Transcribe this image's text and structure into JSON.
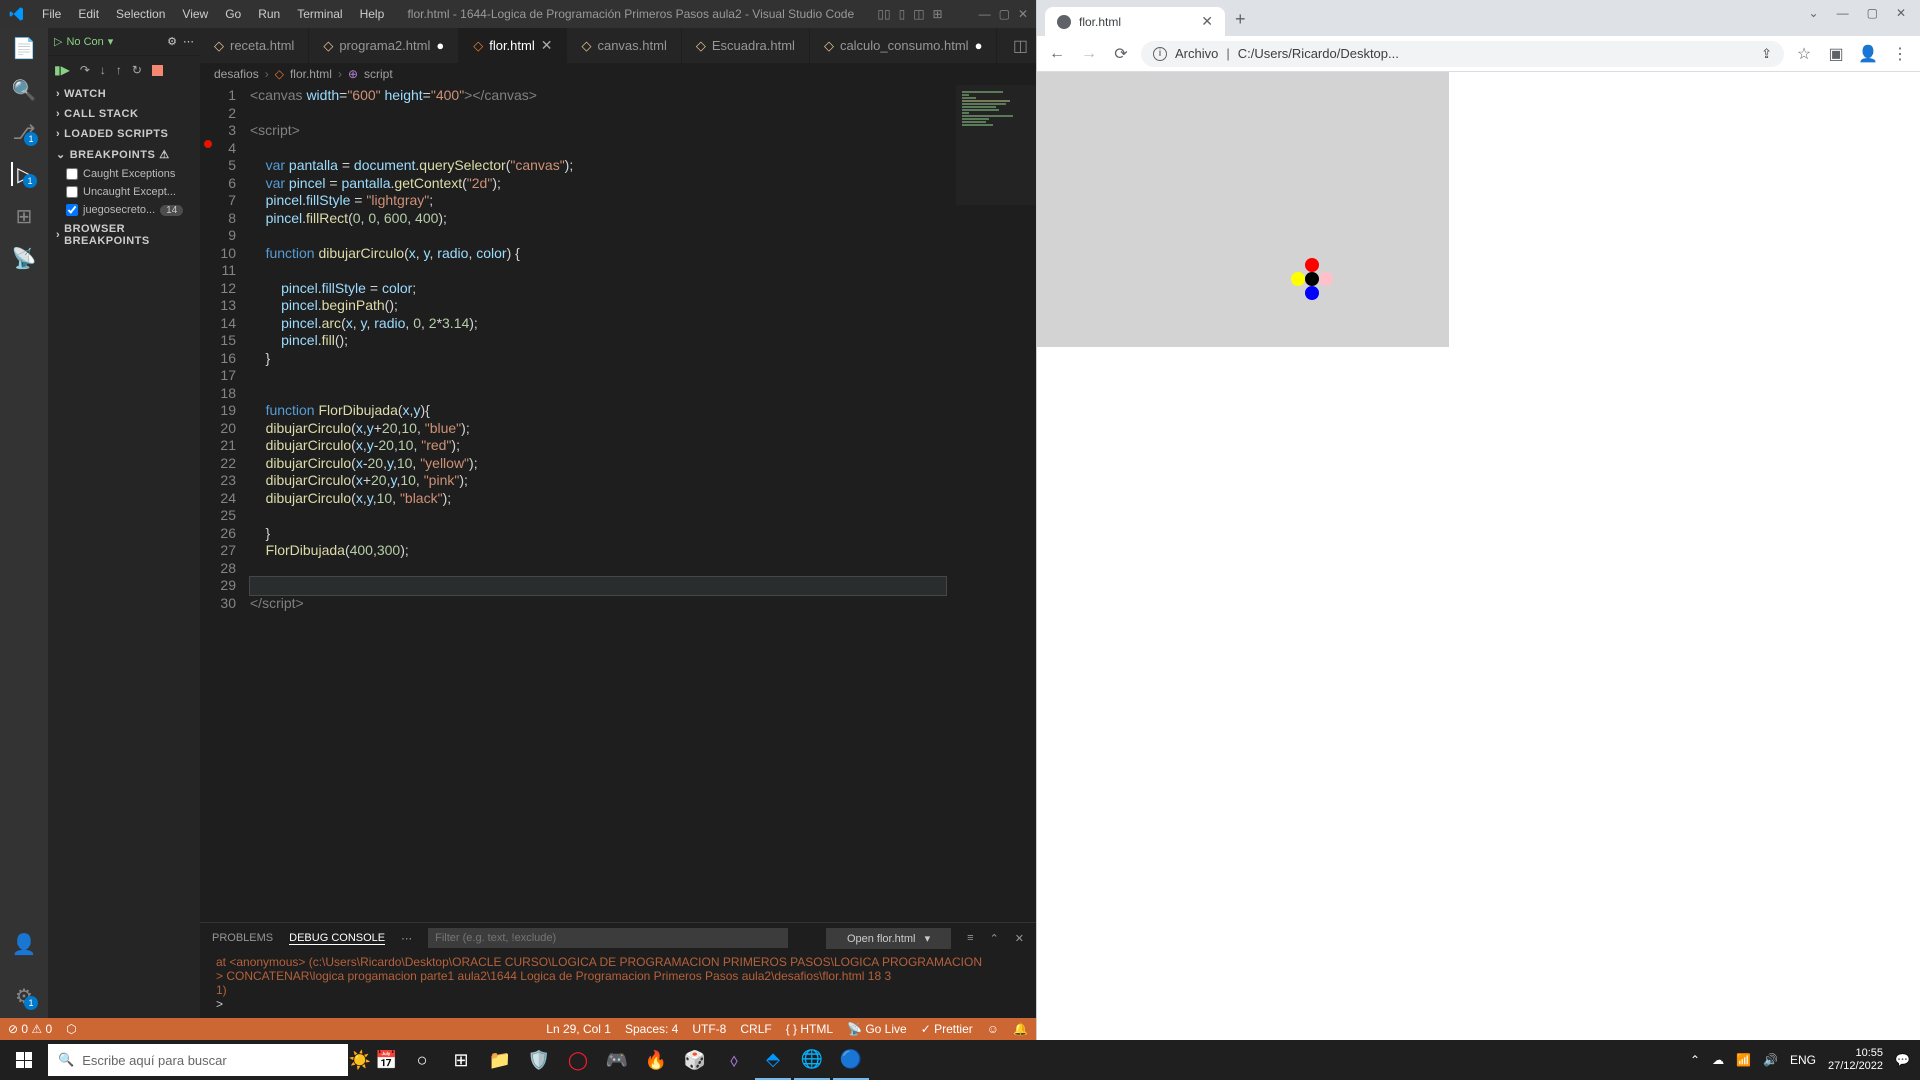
{
  "vscode": {
    "menus": [
      "File",
      "Edit",
      "Selection",
      "View",
      "Go",
      "Run",
      "Terminal",
      "Help"
    ],
    "title": "flor.html - 1644-Logica de Programación Primeros Pasos aula2 - Visual Studio Code",
    "tabs": [
      {
        "label": "receta.html",
        "modified": false,
        "active": false
      },
      {
        "label": "programa2.html",
        "modified": true,
        "active": false
      },
      {
        "label": "flor.html",
        "modified": false,
        "active": true
      },
      {
        "label": "canvas.html",
        "modified": false,
        "active": false
      },
      {
        "label": "Escuadra.html",
        "modified": false,
        "active": false
      },
      {
        "label": "calculo_consumo.html",
        "modified": true,
        "active": false
      }
    ],
    "breadcrumb": [
      "desafios",
      "flor.html",
      "script"
    ],
    "run_config": "No Con",
    "sidebar": {
      "sections": {
        "watch": "WATCH",
        "callstack": "CALL STACK",
        "loaded": "LOADED SCRIPTS",
        "breakpoints": "BREAKPOINTS",
        "browser_bp": "BROWSER BREAKPOINTS"
      },
      "bp_items": [
        {
          "label": "Caught Exceptions",
          "checked": false
        },
        {
          "label": "Uncaught Except...",
          "checked": false
        },
        {
          "label": "juegosecreto...",
          "checked": true,
          "badge": "14"
        }
      ]
    },
    "panel": {
      "tabs": [
        "PROBLEMS",
        "DEBUG CONSOLE"
      ],
      "filter_placeholder": "Filter (e.g. text, !exclude)",
      "launch": "Open flor.html",
      "lines": [
        "    at <anonymous> (c:\\Users\\Ricardo\\Desktop\\ORACLE CURSO\\LOGICA DE PROGRAMACION PRIMEROS PASOS\\LOGICA PROGRAMACION",
        "> CONCATENAR\\logica progamacion parte1 aula2\\1644 Logica de Programacion Primeros Pasos aula2\\desafios\\flor.html 18 3",
        "  1)",
        ">"
      ]
    },
    "status": {
      "errors": "⊘ 0 ⚠ 0",
      "port": "⬡",
      "ln": "Ln 29, Col 1",
      "spaces": "Spaces: 4",
      "encoding": "UTF-8",
      "eol": "CRLF",
      "lang": "HTML",
      "golive": "Go Live",
      "prettier": "Prettier"
    },
    "code": {
      "lines": 30
    }
  },
  "browser": {
    "tab_title": "flor.html",
    "url_prefix": "Archivo",
    "url": "C:/Users/Ricardo/Desktop..."
  },
  "taskbar": {
    "search_placeholder": "Escribe aquí para buscar",
    "lang": "ENG",
    "time": "10:55",
    "date": "27/12/2022"
  }
}
